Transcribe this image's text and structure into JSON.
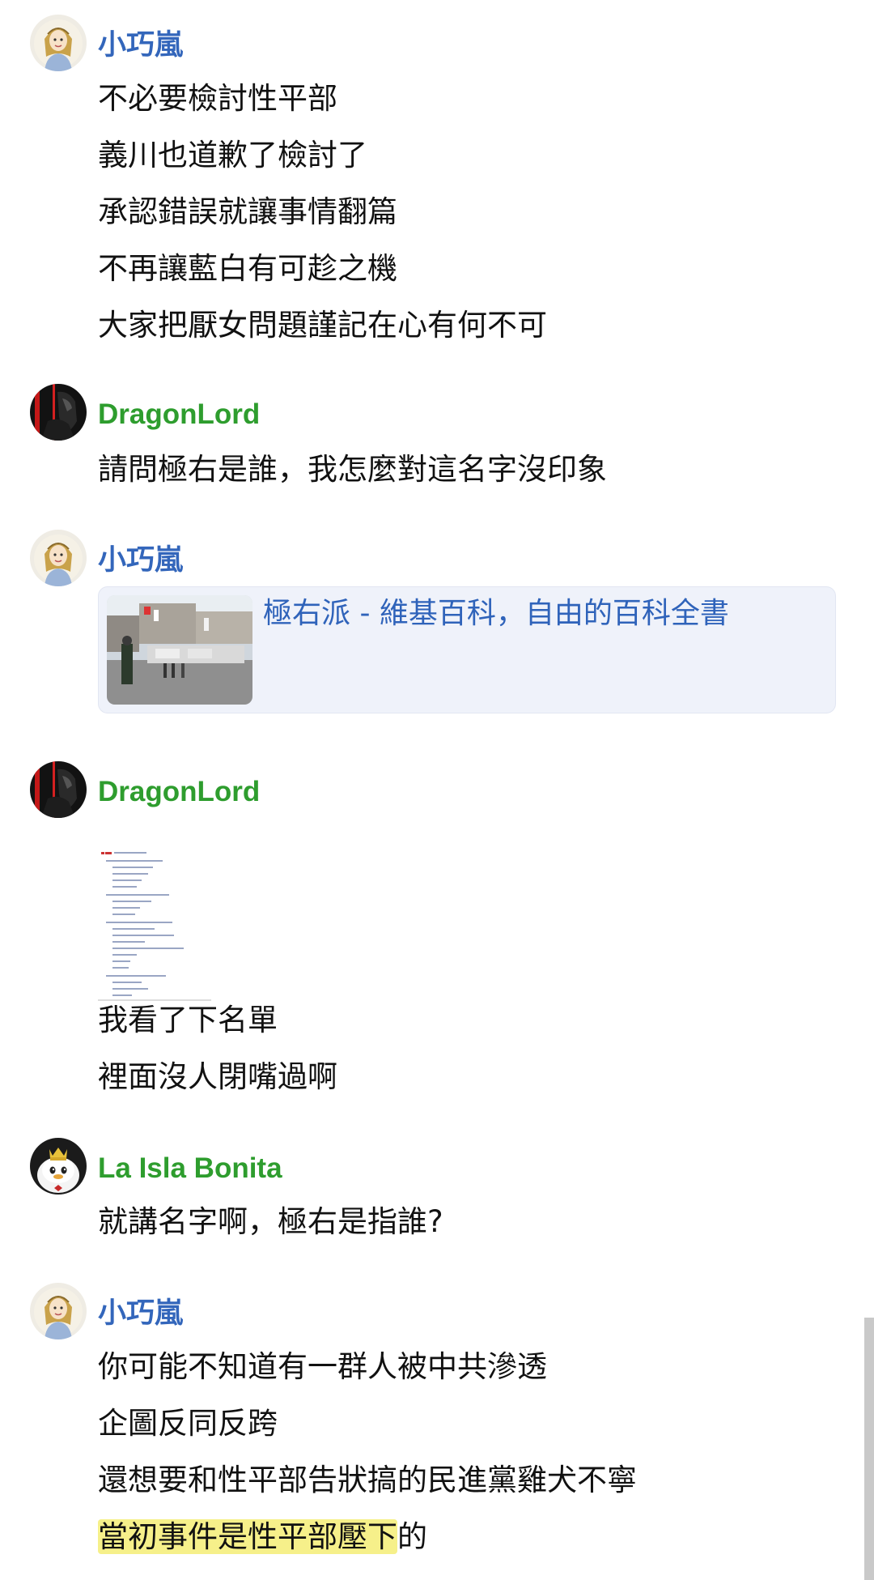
{
  "colors": {
    "name_blue": "#3366bb",
    "name_green": "#2e9d2e",
    "link_blue": "#2f63ba",
    "text": "#111111",
    "highlight": "#f6f08a"
  },
  "messages": [
    {
      "author": "小巧嵐",
      "author_color": "#3366bb",
      "avatar_icon": "girl-avatar-icon",
      "lines": [
        "不必要檢討性平部",
        "義川也道歉了檢討了",
        "承認錯誤就讓事情翻篇",
        "不再讓藍白有可趁之機",
        "大家把厭女問題謹記在心有何不可"
      ]
    },
    {
      "author": "DragonLord",
      "author_color": "#2e9d2e",
      "avatar_icon": "dark-knight-avatar-icon",
      "lines": [
        "請問極右是誰，我怎麼對這名字沒印象"
      ]
    },
    {
      "author": "小巧嵐",
      "author_color": "#3366bb",
      "avatar_icon": "girl-avatar-icon",
      "link_card": {
        "title": "極右派 - 維基百科，自由的百科全書",
        "thumbnail_icon": "street-rally-photo-icon"
      }
    },
    {
      "author": "DragonLord",
      "author_color": "#2e9d2e",
      "avatar_icon": "dark-knight-avatar-icon",
      "attachment_icon": "document-list-thumbnail-icon",
      "lines": [
        "我看了下名單",
        "裡面沒人閉嘴過啊"
      ]
    },
    {
      "author": "La Isla Bonita",
      "author_color": "#2e9d2e",
      "avatar_icon": "crowned-penguin-avatar-icon",
      "lines": [
        "就講名字啊，極右是指誰?"
      ]
    },
    {
      "author": "小巧嵐",
      "author_color": "#3366bb",
      "avatar_icon": "girl-avatar-icon",
      "lines": [
        "你可能不知道有一群人被中共滲透",
        "企圖反同反跨",
        "還想要和性平部告狀搞的民進黨雞犬不寧"
      ],
      "last_line": {
        "highlighted": "當初事件是性平部壓下",
        "rest": "的"
      }
    }
  ]
}
